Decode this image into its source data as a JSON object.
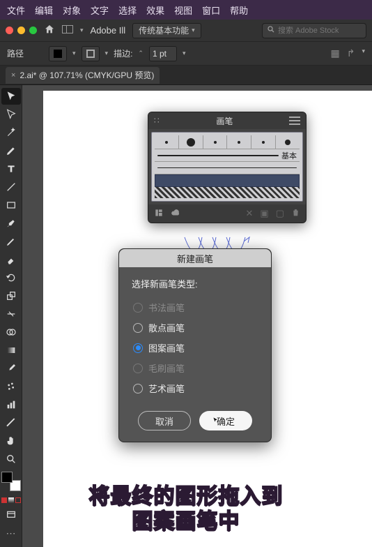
{
  "menubar": {
    "items": [
      "文件",
      "编辑",
      "对象",
      "文字",
      "选择",
      "效果",
      "视图",
      "窗口",
      "帮助"
    ]
  },
  "appbar": {
    "app_name": "Adobe Ill",
    "workspace": "传统基本功能",
    "search_placeholder": "搜索 Adobe Stock"
  },
  "optbar": {
    "label_noselection": "路径",
    "stroke_label": "描边:",
    "stroke_value": "1 pt"
  },
  "doc_tab": {
    "title": "2.ai* @ 107.71% (CMYK/GPU 预览)"
  },
  "brush_panel": {
    "title": "画笔",
    "basic_label": "基本"
  },
  "dialog": {
    "title": "新建画笔",
    "prompt": "选择新画笔类型:",
    "options": {
      "calligraphy": "书法画笔",
      "scatter": "散点画笔",
      "pattern": "图案画笔",
      "bristle": "毛刷画笔",
      "art": "艺术画笔"
    },
    "selected": "pattern",
    "disabled": [
      "calligraphy",
      "bristle"
    ],
    "cancel": "取消",
    "ok": "确定"
  },
  "caption": {
    "line1": "将最终的图形拖入到",
    "line2": "图案画笔中"
  },
  "tools": [
    "selection",
    "direct-select",
    "pen",
    "curvature",
    "type",
    "line",
    "rectangle",
    "paintbrush",
    "pencil",
    "eraser",
    "rotate",
    "scale",
    "width",
    "free-transform",
    "shape-builder",
    "gradient",
    "eyedropper",
    "blend",
    "symbol-sprayer",
    "column-graph",
    "slice",
    "hand",
    "zoom"
  ]
}
